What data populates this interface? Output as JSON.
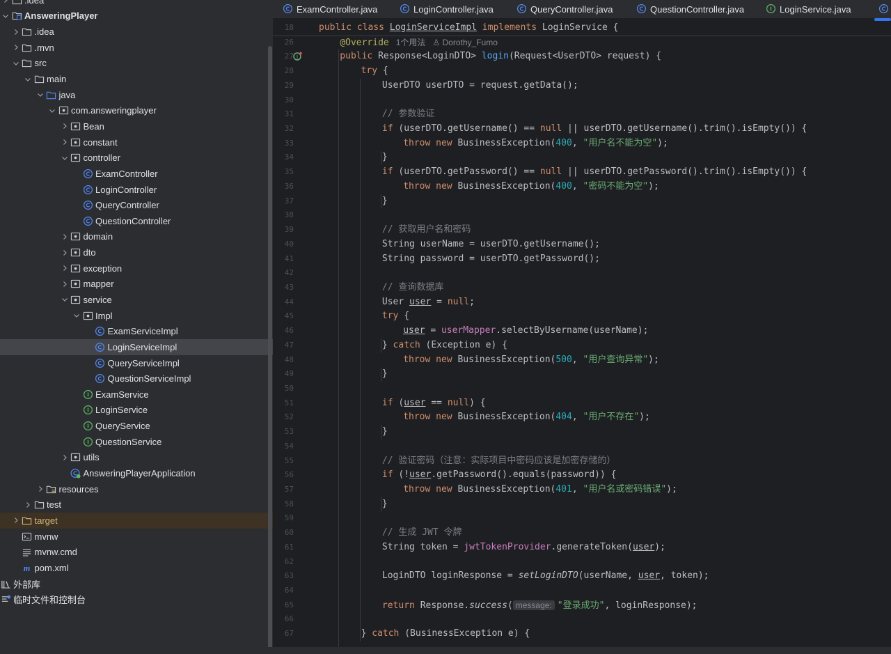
{
  "tree": {
    "rows": [
      {
        "label": ".idea",
        "depth": 0,
        "expand": "right",
        "icon": "folder-icon"
      },
      {
        "label": "AnsweringPlayer",
        "depth": 0,
        "expand": "down",
        "icon": "module-folder-icon",
        "bold": true
      },
      {
        "label": ".idea",
        "depth": 1,
        "expand": "right",
        "icon": "folder-icon"
      },
      {
        "label": ".mvn",
        "depth": 1,
        "expand": "right",
        "icon": "folder-icon"
      },
      {
        "label": "src",
        "depth": 1,
        "expand": "down",
        "icon": "folder-icon"
      },
      {
        "label": "main",
        "depth": 2,
        "expand": "down",
        "icon": "folder-icon"
      },
      {
        "label": "java",
        "depth": 3,
        "expand": "down",
        "icon": "source-folder-icon"
      },
      {
        "label": "com.answeringplayer",
        "depth": 4,
        "expand": "down",
        "icon": "package-icon"
      },
      {
        "label": "Bean",
        "depth": 5,
        "expand": "right",
        "icon": "package-icon"
      },
      {
        "label": "constant",
        "depth": 5,
        "expand": "right",
        "icon": "package-icon"
      },
      {
        "label": "controller",
        "depth": 5,
        "expand": "down",
        "icon": "package-icon"
      },
      {
        "label": "ExamController",
        "depth": 6,
        "expand": "none",
        "icon": "class-icon"
      },
      {
        "label": "LoginController",
        "depth": 6,
        "expand": "none",
        "icon": "class-icon"
      },
      {
        "label": "QueryController",
        "depth": 6,
        "expand": "none",
        "icon": "class-icon"
      },
      {
        "label": "QuestionController",
        "depth": 6,
        "expand": "none",
        "icon": "class-icon"
      },
      {
        "label": "domain",
        "depth": 5,
        "expand": "right",
        "icon": "package-icon"
      },
      {
        "label": "dto",
        "depth": 5,
        "expand": "right",
        "icon": "package-icon"
      },
      {
        "label": "exception",
        "depth": 5,
        "expand": "right",
        "icon": "package-icon"
      },
      {
        "label": "mapper",
        "depth": 5,
        "expand": "right",
        "icon": "package-icon"
      },
      {
        "label": "service",
        "depth": 5,
        "expand": "down",
        "icon": "package-icon"
      },
      {
        "label": "Impl",
        "depth": 6,
        "expand": "down",
        "icon": "package-icon"
      },
      {
        "label": "ExamServiceImpl",
        "depth": 7,
        "expand": "none",
        "icon": "class-icon"
      },
      {
        "label": "LoginServiceImpl",
        "depth": 7,
        "expand": "none",
        "icon": "class-icon",
        "selected": true
      },
      {
        "label": "QueryServiceImpl",
        "depth": 7,
        "expand": "none",
        "icon": "class-icon"
      },
      {
        "label": "QuestionServiceImpl",
        "depth": 7,
        "expand": "none",
        "icon": "class-icon"
      },
      {
        "label": "ExamService",
        "depth": 6,
        "expand": "none",
        "icon": "interface-icon"
      },
      {
        "label": "LoginService",
        "depth": 6,
        "expand": "none",
        "icon": "interface-icon"
      },
      {
        "label": "QueryService",
        "depth": 6,
        "expand": "none",
        "icon": "interface-icon"
      },
      {
        "label": "QuestionService",
        "depth": 6,
        "expand": "none",
        "icon": "interface-icon"
      },
      {
        "label": "utils",
        "depth": 5,
        "expand": "right",
        "icon": "package-icon"
      },
      {
        "label": "AnsweringPlayerApplication",
        "depth": 5,
        "expand": "none",
        "icon": "spring-app-icon"
      },
      {
        "label": "resources",
        "depth": 3,
        "expand": "right",
        "icon": "resources-folder-icon"
      },
      {
        "label": "test",
        "depth": 2,
        "expand": "right",
        "icon": "folder-icon"
      },
      {
        "label": "target",
        "depth": 1,
        "expand": "right",
        "icon": "excluded-folder-icon",
        "excluded": true
      },
      {
        "label": "mvnw",
        "depth": 1,
        "expand": "none",
        "icon": "terminal-file-icon"
      },
      {
        "label": "mvnw.cmd",
        "depth": 1,
        "expand": "none",
        "icon": "text-file-icon"
      },
      {
        "label": "pom.xml",
        "depth": 1,
        "expand": "none",
        "icon": "maven-icon"
      },
      {
        "label": "外部库",
        "depth": -1,
        "expand": "none",
        "icon": "library-icon"
      },
      {
        "label": "临时文件和控制台",
        "depth": -1,
        "expand": "none",
        "icon": "scratch-icon"
      }
    ]
  },
  "tabs": [
    {
      "label": "ExamController.java",
      "icon": "class-icon"
    },
    {
      "label": "LoginController.java",
      "icon": "class-icon"
    },
    {
      "label": "QueryController.java",
      "icon": "class-icon"
    },
    {
      "label": "QuestionController.java",
      "icon": "class-icon"
    },
    {
      "label": "LoginService.java",
      "icon": "interface-icon"
    }
  ],
  "editor": {
    "lines": [
      {
        "n": "18",
        "indent": 0,
        "tokens": [
          [
            "kw",
            "public class "
          ],
          [
            "ul",
            "LoginServiceImpl"
          ],
          [
            "kw",
            " implements "
          ],
          [
            "",
            "LoginService {"
          ]
        ]
      },
      {
        "n": "26",
        "indent": 1,
        "tokens": [
          [
            "an",
            "@Override"
          ],
          [
            "hint",
            "   1个用法   ♙ Dorothy_Fumo"
          ]
        ]
      },
      {
        "n": "27",
        "indent": 1,
        "tokens": [
          [
            "kw",
            "public "
          ],
          [
            "",
            "Response<LoginDTO> "
          ],
          [
            "fn",
            "login"
          ],
          [
            "",
            "(Request<UserDTO> request) {"
          ]
        ]
      },
      {
        "n": "28",
        "indent": 2,
        "tokens": [
          [
            "kw",
            "try "
          ],
          [
            "",
            "{"
          ]
        ]
      },
      {
        "n": "29",
        "indent": 3,
        "tokens": [
          [
            "",
            "UserDTO userDTO = request.getData();"
          ]
        ]
      },
      {
        "n": "30",
        "indent": 0,
        "tokens": []
      },
      {
        "n": "31",
        "indent": 3,
        "tokens": [
          [
            "cm",
            "// 参数验证"
          ]
        ]
      },
      {
        "n": "32",
        "indent": 3,
        "tokens": [
          [
            "kw",
            "if "
          ],
          [
            "",
            "(userDTO.getUsername() == "
          ],
          [
            "kw",
            "null"
          ],
          [
            "",
            " || userDTO.getUsername().trim().isEmpty()) {"
          ]
        ]
      },
      {
        "n": "33",
        "indent": 4,
        "tokens": [
          [
            "kw",
            "throw new "
          ],
          [
            "",
            "BusinessException("
          ],
          [
            "num",
            "400"
          ],
          [
            "",
            ", "
          ],
          [
            "str",
            "\"用户名不能为空\""
          ],
          [
            "",
            ");"
          ]
        ]
      },
      {
        "n": "34",
        "indent": 3,
        "tokens": [
          [
            "",
            "}"
          ]
        ]
      },
      {
        "n": "35",
        "indent": 3,
        "tokens": [
          [
            "kw",
            "if "
          ],
          [
            "",
            "(userDTO.getPassword() == "
          ],
          [
            "kw",
            "null"
          ],
          [
            "",
            " || userDTO.getPassword().trim().isEmpty()) {"
          ]
        ]
      },
      {
        "n": "36",
        "indent": 4,
        "tokens": [
          [
            "kw",
            "throw new "
          ],
          [
            "",
            "BusinessException("
          ],
          [
            "num",
            "400"
          ],
          [
            "",
            ", "
          ],
          [
            "str",
            "\"密码不能为空\""
          ],
          [
            "",
            ");"
          ]
        ]
      },
      {
        "n": "37",
        "indent": 3,
        "tokens": [
          [
            "",
            "}"
          ]
        ]
      },
      {
        "n": "38",
        "indent": 0,
        "tokens": []
      },
      {
        "n": "39",
        "indent": 3,
        "tokens": [
          [
            "cm",
            "// 获取用户名和密码"
          ]
        ]
      },
      {
        "n": "40",
        "indent": 3,
        "tokens": [
          [
            "",
            "String userName = userDTO.getUsername();"
          ]
        ]
      },
      {
        "n": "41",
        "indent": 3,
        "tokens": [
          [
            "",
            "String password = userDTO.getPassword();"
          ]
        ]
      },
      {
        "n": "42",
        "indent": 0,
        "tokens": []
      },
      {
        "n": "43",
        "indent": 3,
        "tokens": [
          [
            "cm",
            "// 查询数据库"
          ]
        ]
      },
      {
        "n": "44",
        "indent": 3,
        "tokens": [
          [
            "",
            "User "
          ],
          [
            "ul",
            "user"
          ],
          [
            "",
            " = "
          ],
          [
            "kw",
            "null"
          ],
          [
            "",
            ";"
          ]
        ]
      },
      {
        "n": "45",
        "indent": 3,
        "tokens": [
          [
            "kw",
            "try "
          ],
          [
            "",
            "{"
          ]
        ]
      },
      {
        "n": "46",
        "indent": 4,
        "tokens": [
          [
            "ul",
            "user"
          ],
          [
            "",
            " = "
          ],
          [
            "fld",
            "userMapper"
          ],
          [
            "",
            ".selectByUsername(userName);"
          ]
        ]
      },
      {
        "n": "47",
        "indent": 3,
        "tokens": [
          [
            "",
            "} "
          ],
          [
            "kw",
            "catch "
          ],
          [
            "",
            "(Exception e) {"
          ]
        ]
      },
      {
        "n": "48",
        "indent": 4,
        "tokens": [
          [
            "kw",
            "throw new "
          ],
          [
            "",
            "BusinessException("
          ],
          [
            "num",
            "500"
          ],
          [
            "",
            ", "
          ],
          [
            "str",
            "\"用户查询异常\""
          ],
          [
            "",
            ");"
          ]
        ]
      },
      {
        "n": "49",
        "indent": 3,
        "tokens": [
          [
            "",
            "}"
          ]
        ]
      },
      {
        "n": "50",
        "indent": 0,
        "tokens": []
      },
      {
        "n": "51",
        "indent": 3,
        "tokens": [
          [
            "kw",
            "if "
          ],
          [
            "",
            "("
          ],
          [
            "ul",
            "user"
          ],
          [
            "",
            " == "
          ],
          [
            "kw",
            "null"
          ],
          [
            "",
            ") {"
          ]
        ]
      },
      {
        "n": "52",
        "indent": 4,
        "tokens": [
          [
            "kw",
            "throw new "
          ],
          [
            "",
            "BusinessException("
          ],
          [
            "num",
            "404"
          ],
          [
            "",
            ", "
          ],
          [
            "str",
            "\"用户不存在\""
          ],
          [
            "",
            ");"
          ]
        ]
      },
      {
        "n": "53",
        "indent": 3,
        "tokens": [
          [
            "",
            "}"
          ]
        ]
      },
      {
        "n": "54",
        "indent": 0,
        "tokens": []
      },
      {
        "n": "55",
        "indent": 3,
        "tokens": [
          [
            "cm",
            "// 验证密码（注意：实际项目中密码应该是加密存储的）"
          ]
        ]
      },
      {
        "n": "56",
        "indent": 3,
        "tokens": [
          [
            "kw",
            "if "
          ],
          [
            "",
            "(!"
          ],
          [
            "ul",
            "user"
          ],
          [
            "",
            ".getPassword().equals(password)) {"
          ]
        ]
      },
      {
        "n": "57",
        "indent": 4,
        "tokens": [
          [
            "kw",
            "throw new "
          ],
          [
            "",
            "BusinessException("
          ],
          [
            "num",
            "401"
          ],
          [
            "",
            ", "
          ],
          [
            "str",
            "\"用户名或密码错误\""
          ],
          [
            "",
            ");"
          ]
        ]
      },
      {
        "n": "58",
        "indent": 3,
        "tokens": [
          [
            "",
            "}"
          ]
        ]
      },
      {
        "n": "59",
        "indent": 0,
        "tokens": []
      },
      {
        "n": "60",
        "indent": 3,
        "tokens": [
          [
            "cm",
            "// 生成 JWT 令牌"
          ]
        ]
      },
      {
        "n": "61",
        "indent": 3,
        "tokens": [
          [
            "",
            "String token = "
          ],
          [
            "fld",
            "jwtTokenProvider"
          ],
          [
            "",
            ".generateToken("
          ],
          [
            "ul",
            "user"
          ],
          [
            "",
            ");"
          ]
        ]
      },
      {
        "n": "62",
        "indent": 0,
        "tokens": []
      },
      {
        "n": "63",
        "indent": 3,
        "tokens": [
          [
            "",
            "LoginDTO loginResponse = "
          ],
          [
            "it",
            "setLoginDTO"
          ],
          [
            "",
            "(userName, "
          ],
          [
            "ul",
            "user"
          ],
          [
            "",
            ", token);"
          ]
        ]
      },
      {
        "n": "64",
        "indent": 0,
        "tokens": []
      },
      {
        "n": "65",
        "indent": 3,
        "tokens": [
          [
            "kw",
            "return "
          ],
          [
            "",
            "Response."
          ],
          [
            "it",
            "success"
          ],
          [
            "",
            "("
          ],
          [
            "hintbox",
            "message:"
          ],
          [
            "str",
            "\"登录成功\""
          ],
          [
            "",
            ", loginResponse);"
          ]
        ]
      },
      {
        "n": "66",
        "indent": 0,
        "tokens": []
      },
      {
        "n": "67",
        "indent": 2,
        "tokens": [
          [
            "",
            "} "
          ],
          [
            "kw",
            "catch "
          ],
          [
            "",
            "(BusinessException e) {"
          ]
        ]
      }
    ]
  },
  "colors": {
    "keyword": "#cf8e6d",
    "function": "#56a8f5",
    "string": "#6aab73",
    "number": "#2aacb8",
    "comment": "#7a7e85",
    "field": "#c77dbb",
    "annotation": "#b3ae60",
    "accent": "#3574f0"
  }
}
